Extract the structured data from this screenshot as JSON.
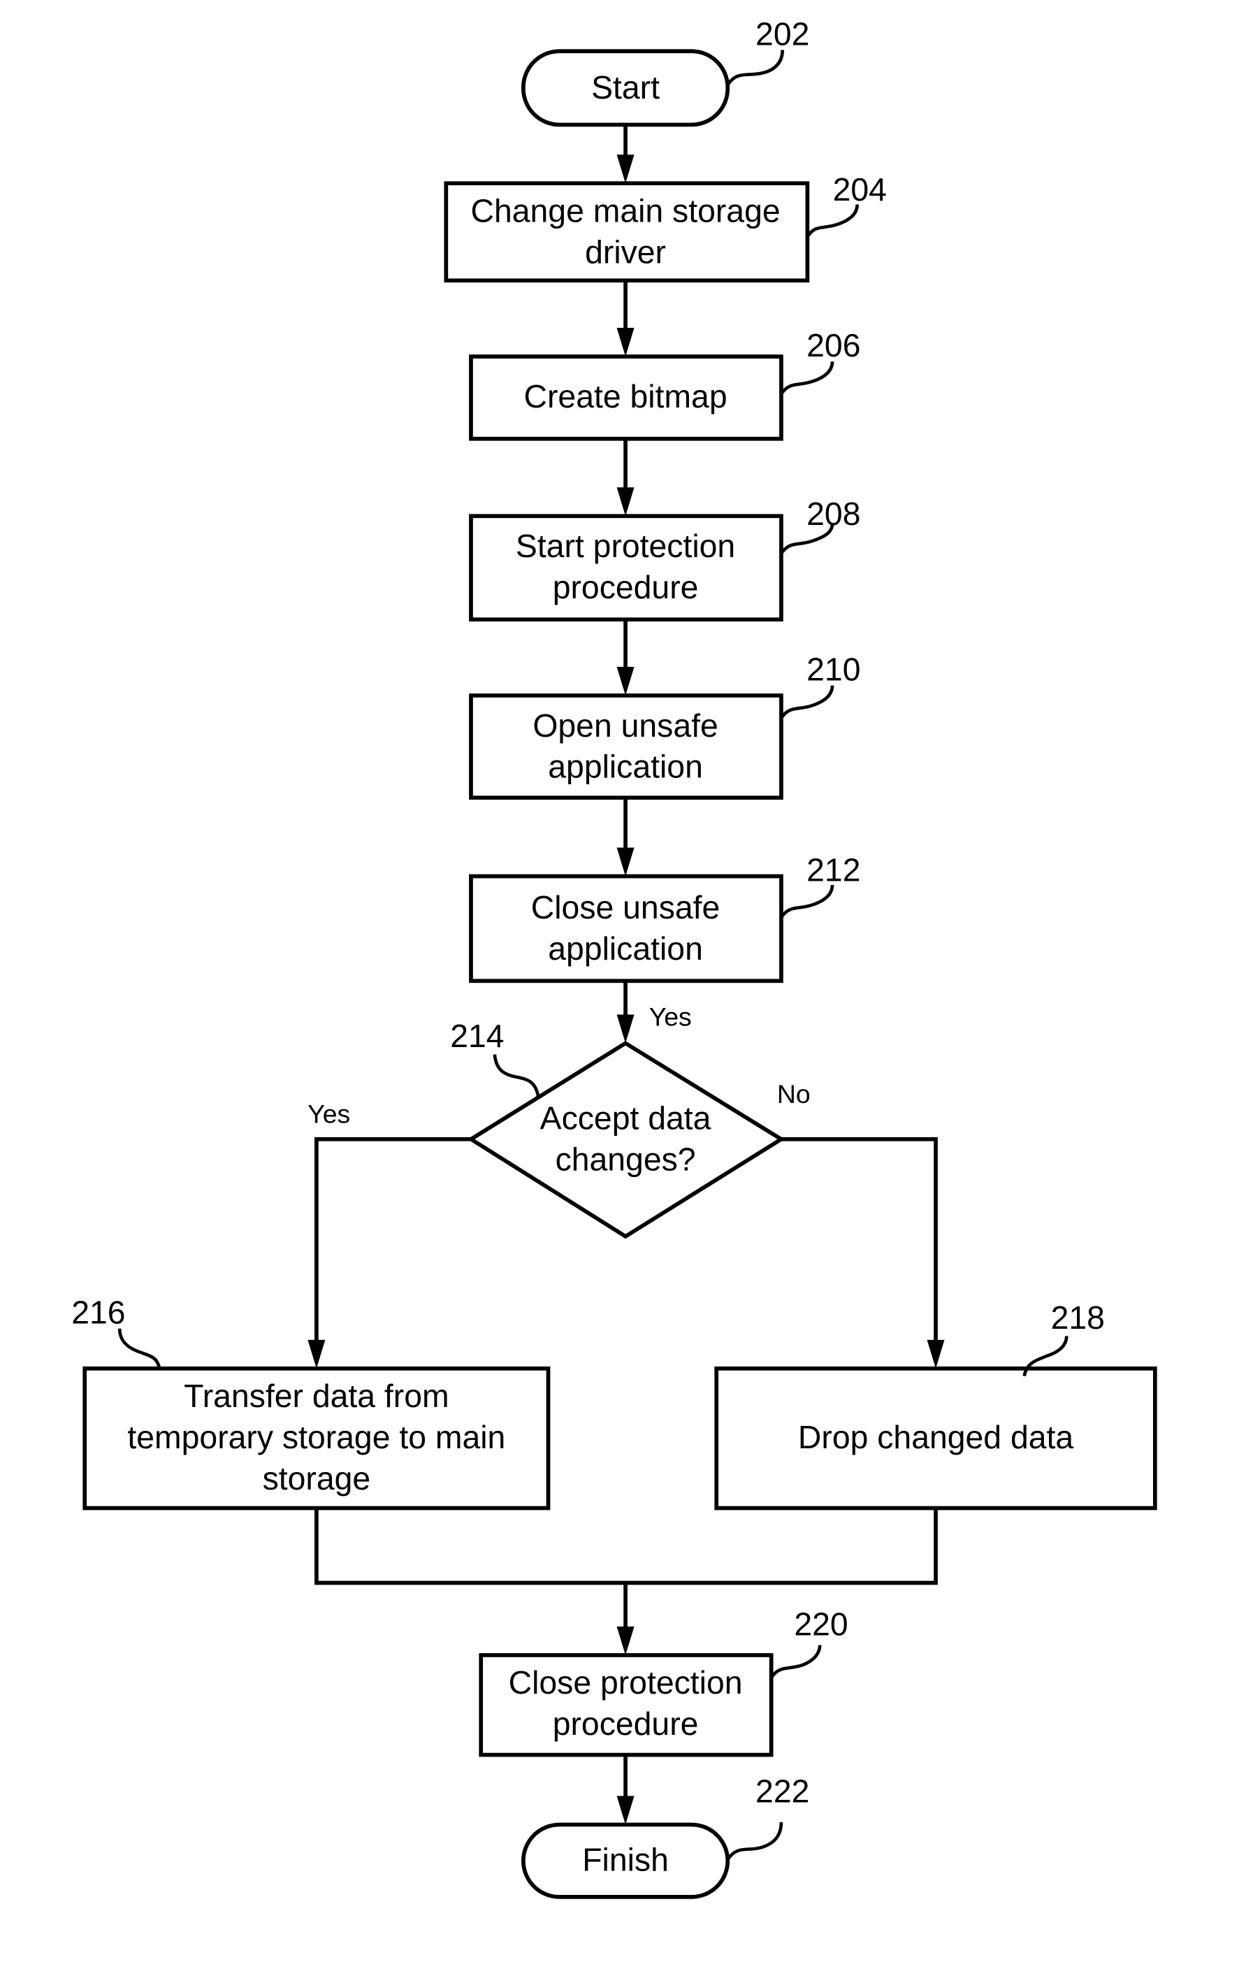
{
  "diagram": {
    "type": "flowchart",
    "nodes": {
      "start": {
        "ref": "202",
        "lines": [
          "Start"
        ]
      },
      "n204": {
        "ref": "204",
        "lines": [
          "Change main storage",
          "driver"
        ]
      },
      "n206": {
        "ref": "206",
        "lines": [
          "Create bitmap"
        ]
      },
      "n208": {
        "ref": "208",
        "lines": [
          "Start protection",
          "procedure"
        ]
      },
      "n210": {
        "ref": "210",
        "lines": [
          "Open unsafe",
          "application"
        ]
      },
      "n212": {
        "ref": "212",
        "lines": [
          "Close unsafe",
          "application"
        ]
      },
      "n214": {
        "ref": "214",
        "lines": [
          "Accept data",
          "changes?"
        ]
      },
      "n216": {
        "ref": "216",
        "lines": [
          "Transfer data from",
          "temporary storage to main",
          "storage"
        ]
      },
      "n218": {
        "ref": "218",
        "lines": [
          "Drop changed data"
        ]
      },
      "n220": {
        "ref": "220",
        "lines": [
          "Close protection",
          "procedure"
        ]
      },
      "finish": {
        "ref": "222",
        "lines": [
          "Finish"
        ]
      }
    },
    "branch_labels": {
      "into_decision": "Yes",
      "decision_yes": "Yes",
      "decision_no": "No"
    }
  }
}
